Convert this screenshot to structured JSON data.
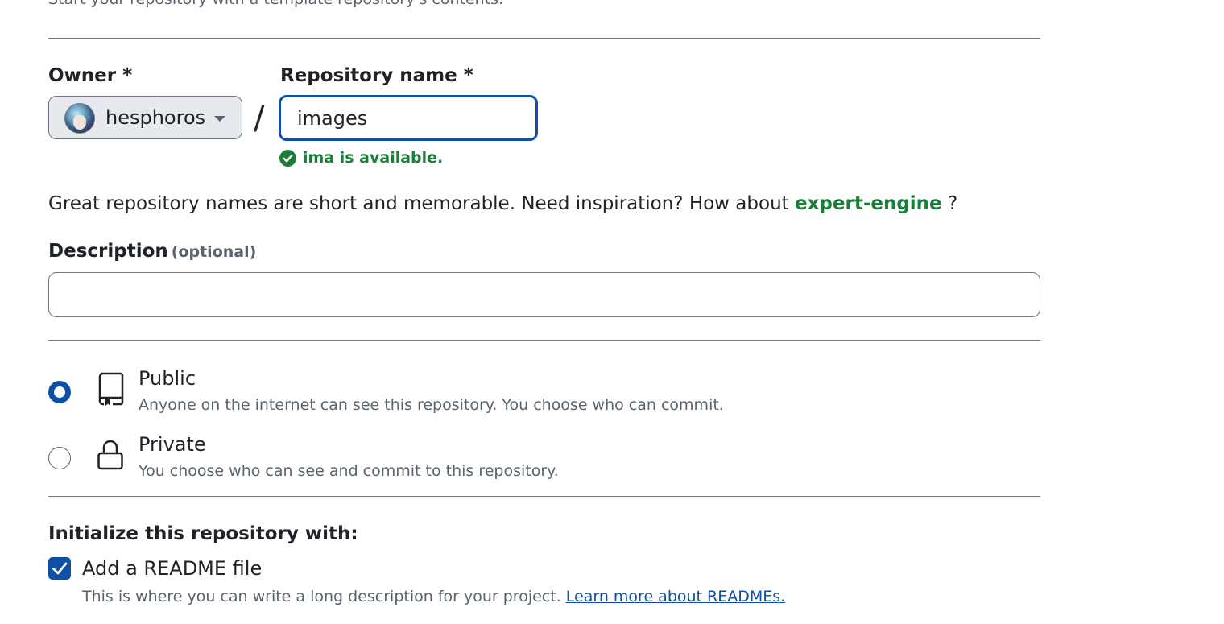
{
  "template": {
    "description": "Start your repository with a template repository's contents."
  },
  "owner": {
    "label": "Owner *",
    "selected": "hesphoros"
  },
  "separator": "/",
  "repo_name": {
    "label": "Repository name *",
    "value": "images",
    "availability": "ima is available."
  },
  "inspiration": {
    "text": "Great repository names are short and memorable. Need inspiration? How about",
    "suggestion": "expert-engine",
    "suffix": "?"
  },
  "description": {
    "label": "Description",
    "optional_note": "(optional)",
    "value": ""
  },
  "visibility": {
    "selected": "Public",
    "options": [
      {
        "title": "Public",
        "subtitle": "Anyone on the internet can see this repository. You choose who can commit.",
        "icon": "repo-icon"
      },
      {
        "title": "Private",
        "subtitle": "You choose who can see and commit to this repository.",
        "icon": "lock-icon"
      }
    ]
  },
  "initialize": {
    "label": "Initialize this repository with:",
    "readme": {
      "checked": true,
      "title": "Add a README file",
      "subtitle": "This is where you can write a long description for your project.",
      "link": "Learn more about READMEs."
    }
  },
  "colors": {
    "accent": "#0f4fa8",
    "success": "#1a7f37",
    "muted": "#59636e"
  }
}
